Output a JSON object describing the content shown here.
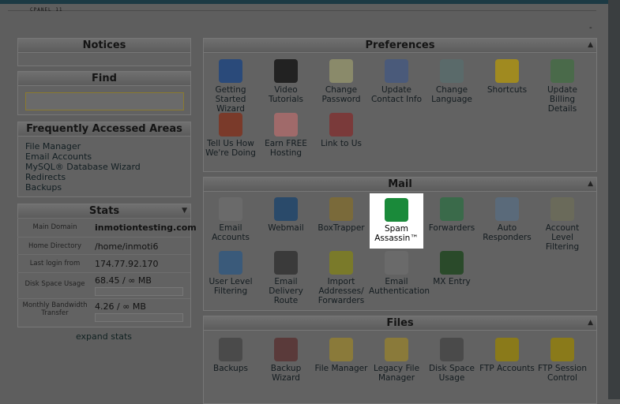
{
  "brand": "CPANEL 11",
  "minus": "-",
  "notices": {
    "title": "Notices"
  },
  "find": {
    "title": "Find",
    "value": ""
  },
  "frequent": {
    "title": "Frequently Accessed Areas",
    "links": [
      "File Manager",
      "Email Accounts",
      "MySQL® Database Wizard",
      "Redirects",
      "Backups"
    ]
  },
  "stats": {
    "title": "Stats",
    "rows": [
      {
        "label": "Main Domain",
        "value": "inmotiontesting.com"
      },
      {
        "label": "Home Directory",
        "value": "/home/inmoti6"
      },
      {
        "label": "Last login from",
        "value": "174.77.92.170"
      },
      {
        "label": "Disk Space Usage",
        "value": "68.45 / ∞ MB"
      },
      {
        "label": "Monthly Bandwidth Transfer",
        "value": "4.26 / ∞ MB"
      }
    ],
    "expand": "expand stats"
  },
  "preferences": {
    "title": "Preferences",
    "items": [
      {
        "label": "Getting Started Wizard",
        "icon": "play-icon",
        "color": "#2a4a7a"
      },
      {
        "label": "Video Tutorials",
        "icon": "video-icon",
        "color": "#222"
      },
      {
        "label": "Change Password",
        "icon": "password-icon",
        "color": "#8a8a6a"
      },
      {
        "label": "Update Contact Info",
        "icon": "contact-icon",
        "color": "#4a5a7a"
      },
      {
        "label": "Change Language",
        "icon": "language-icon",
        "color": "#5a6a6a"
      },
      {
        "label": "Shortcuts",
        "icon": "star-icon",
        "color": "#a08a20"
      },
      {
        "label": "Update Billing Details",
        "icon": "billing-icon",
        "color": "#4a6a4a"
      },
      {
        "label": "Tell Us How We're Doing",
        "icon": "megaphone-icon",
        "color": "#7a3a2a"
      },
      {
        "label": "Earn FREE Hosting",
        "icon": "piggy-bank-icon",
        "color": "#a06a6a"
      },
      {
        "label": "Link to Us",
        "icon": "link-icon",
        "color": "#7a3a3a"
      }
    ]
  },
  "mail": {
    "title": "Mail",
    "items": [
      {
        "label": "Email Accounts",
        "icon": "envelope-icon",
        "color": "#6a6a6a"
      },
      {
        "label": "Webmail",
        "icon": "globe-icon",
        "color": "#2a4a6a"
      },
      {
        "label": "BoxTrapper",
        "icon": "boxtrapper-icon",
        "color": "#7a6a3a"
      },
      {
        "label": "Spam Assassin™",
        "icon": "spamassassin-icon",
        "color": "#1a8a3a",
        "highlight": true
      },
      {
        "label": "Forwarders",
        "icon": "forward-icon",
        "color": "#3a6a4a"
      },
      {
        "label": "Auto Responders",
        "icon": "autoresponder-icon",
        "color": "#5a6a7a"
      },
      {
        "label": "Account Level Filtering",
        "icon": "filter-icon",
        "color": "#6a6a5a"
      },
      {
        "label": "User Level Filtering",
        "icon": "user-filter-icon",
        "color": "#3a5a7a"
      },
      {
        "label": "Email Delivery Route",
        "icon": "delivery-route-icon",
        "color": "#3a3a3a"
      },
      {
        "label": "Import Addresses/ Forwarders",
        "icon": "import-icon",
        "color": "#7a7a2a"
      },
      {
        "label": "Email Authentication",
        "icon": "authentication-icon",
        "color": "#6a6a6a"
      },
      {
        "label": "MX Entry",
        "icon": "mx-entry-icon",
        "color": "#2a4a2a"
      }
    ]
  },
  "files": {
    "title": "Files",
    "items": [
      {
        "label": "Backups",
        "icon": "backup-icon",
        "color": "#4a4a4a"
      },
      {
        "label": "Backup Wizard",
        "icon": "backup-wizard-icon",
        "color": "#5a3a3a"
      },
      {
        "label": "File Manager",
        "icon": "folder-icon",
        "color": "#8a7a3a"
      },
      {
        "label": "Legacy File Manager",
        "icon": "legacy-folder-icon",
        "color": "#8a7a3a"
      },
      {
        "label": "Disk Space Usage",
        "icon": "disk-icon",
        "color": "#4a4a4a"
      },
      {
        "label": "FTP Accounts",
        "icon": "ftp-icon",
        "color": "#8a7a1a"
      },
      {
        "label": "FTP Session Control",
        "icon": "ftp-session-icon",
        "color": "#8a7a1a"
      }
    ]
  }
}
